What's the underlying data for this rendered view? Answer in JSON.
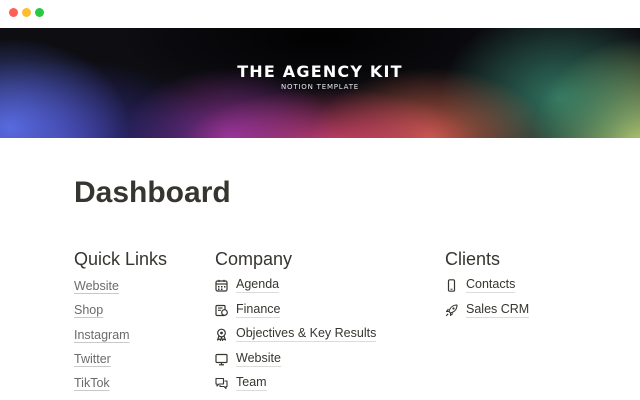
{
  "cover": {
    "title": "THE AGENCY KIT",
    "subtitle": "NOTION TEMPLATE"
  },
  "page": {
    "title": "Dashboard"
  },
  "quick_links": {
    "heading": "Quick Links",
    "items": [
      {
        "label": "Website"
      },
      {
        "label": "Shop"
      },
      {
        "label": "Instagram"
      },
      {
        "label": "Twitter"
      },
      {
        "label": "TikTok"
      }
    ]
  },
  "company": {
    "heading": "Company",
    "items": [
      {
        "label": "Agenda",
        "icon": "calendar-icon"
      },
      {
        "label": "Finance",
        "icon": "finance-icon"
      },
      {
        "label": "Objectives & Key Results",
        "icon": "award-icon"
      },
      {
        "label": "Website",
        "icon": "monitor-icon"
      },
      {
        "label": "Team",
        "icon": "chat-bubbles-icon"
      }
    ]
  },
  "clients": {
    "heading": "Clients",
    "items": [
      {
        "label": "Contacts",
        "icon": "phone-icon"
      },
      {
        "label": "Sales CRM",
        "icon": "rocket-icon"
      }
    ]
  }
}
